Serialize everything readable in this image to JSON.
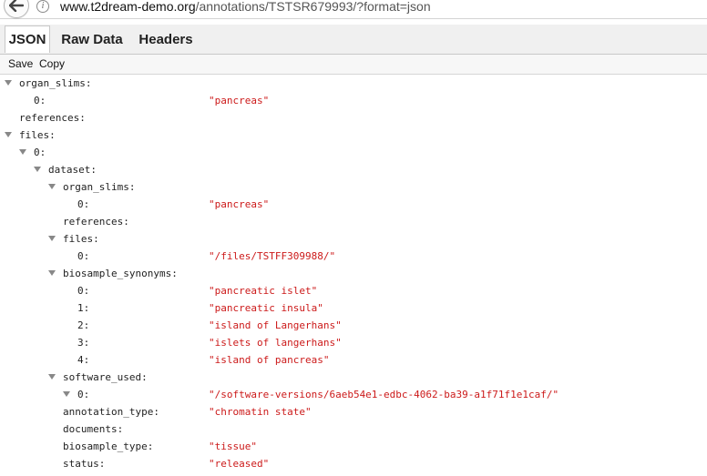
{
  "browser": {
    "url_host": "www.t2dream-demo.org",
    "url_path": "/annotations/TSTSR679993/?format=json",
    "info_glyph": "i"
  },
  "tabs": {
    "json": "JSON",
    "raw_data": "Raw Data",
    "headers": "Headers"
  },
  "toolbar": {
    "save": "Save",
    "copy": "Copy"
  },
  "tree": [
    {
      "key": "organ_slims:",
      "value": "",
      "expandable": true
    },
    {
      "key": "0:",
      "value": "\"pancreas\"",
      "expandable": false
    },
    {
      "key": "references:",
      "value": "",
      "expandable": false
    },
    {
      "key": "files:",
      "value": "",
      "expandable": true
    },
    {
      "key": "0:",
      "value": "",
      "expandable": true
    },
    {
      "key": "dataset:",
      "value": "",
      "expandable": true
    },
    {
      "key": "organ_slims:",
      "value": "",
      "expandable": true
    },
    {
      "key": "0:",
      "value": "\"pancreas\"",
      "expandable": false
    },
    {
      "key": "references:",
      "value": "",
      "expandable": false
    },
    {
      "key": "files:",
      "value": "",
      "expandable": true
    },
    {
      "key": "0:",
      "value": "\"/files/TSTFF309988/\"",
      "expandable": false
    },
    {
      "key": "biosample_synonyms:",
      "value": "",
      "expandable": true
    },
    {
      "key": "0:",
      "value": "\"pancreatic islet\"",
      "expandable": false
    },
    {
      "key": "1:",
      "value": "\"pancreatic insula\"",
      "expandable": false
    },
    {
      "key": "2:",
      "value": "\"island of Langerhans\"",
      "expandable": false
    },
    {
      "key": "3:",
      "value": "\"islets of langerhans\"",
      "expandable": false
    },
    {
      "key": "4:",
      "value": "\"island of pancreas\"",
      "expandable": false
    },
    {
      "key": "software_used:",
      "value": "",
      "expandable": true
    },
    {
      "key": "0:",
      "value": "\"/software-versions/6aeb54e1-edbc-4062-ba39-a1f71f1e1caf/\"",
      "expandable": true
    },
    {
      "key": "annotation_type:",
      "value": "\"chromatin state\"",
      "expandable": false
    },
    {
      "key": "documents:",
      "value": "",
      "expandable": false
    },
    {
      "key": "biosample_type:",
      "value": "\"tissue\"",
      "expandable": false
    },
    {
      "key": "status:",
      "value": "\"released\"",
      "expandable": false
    }
  ]
}
